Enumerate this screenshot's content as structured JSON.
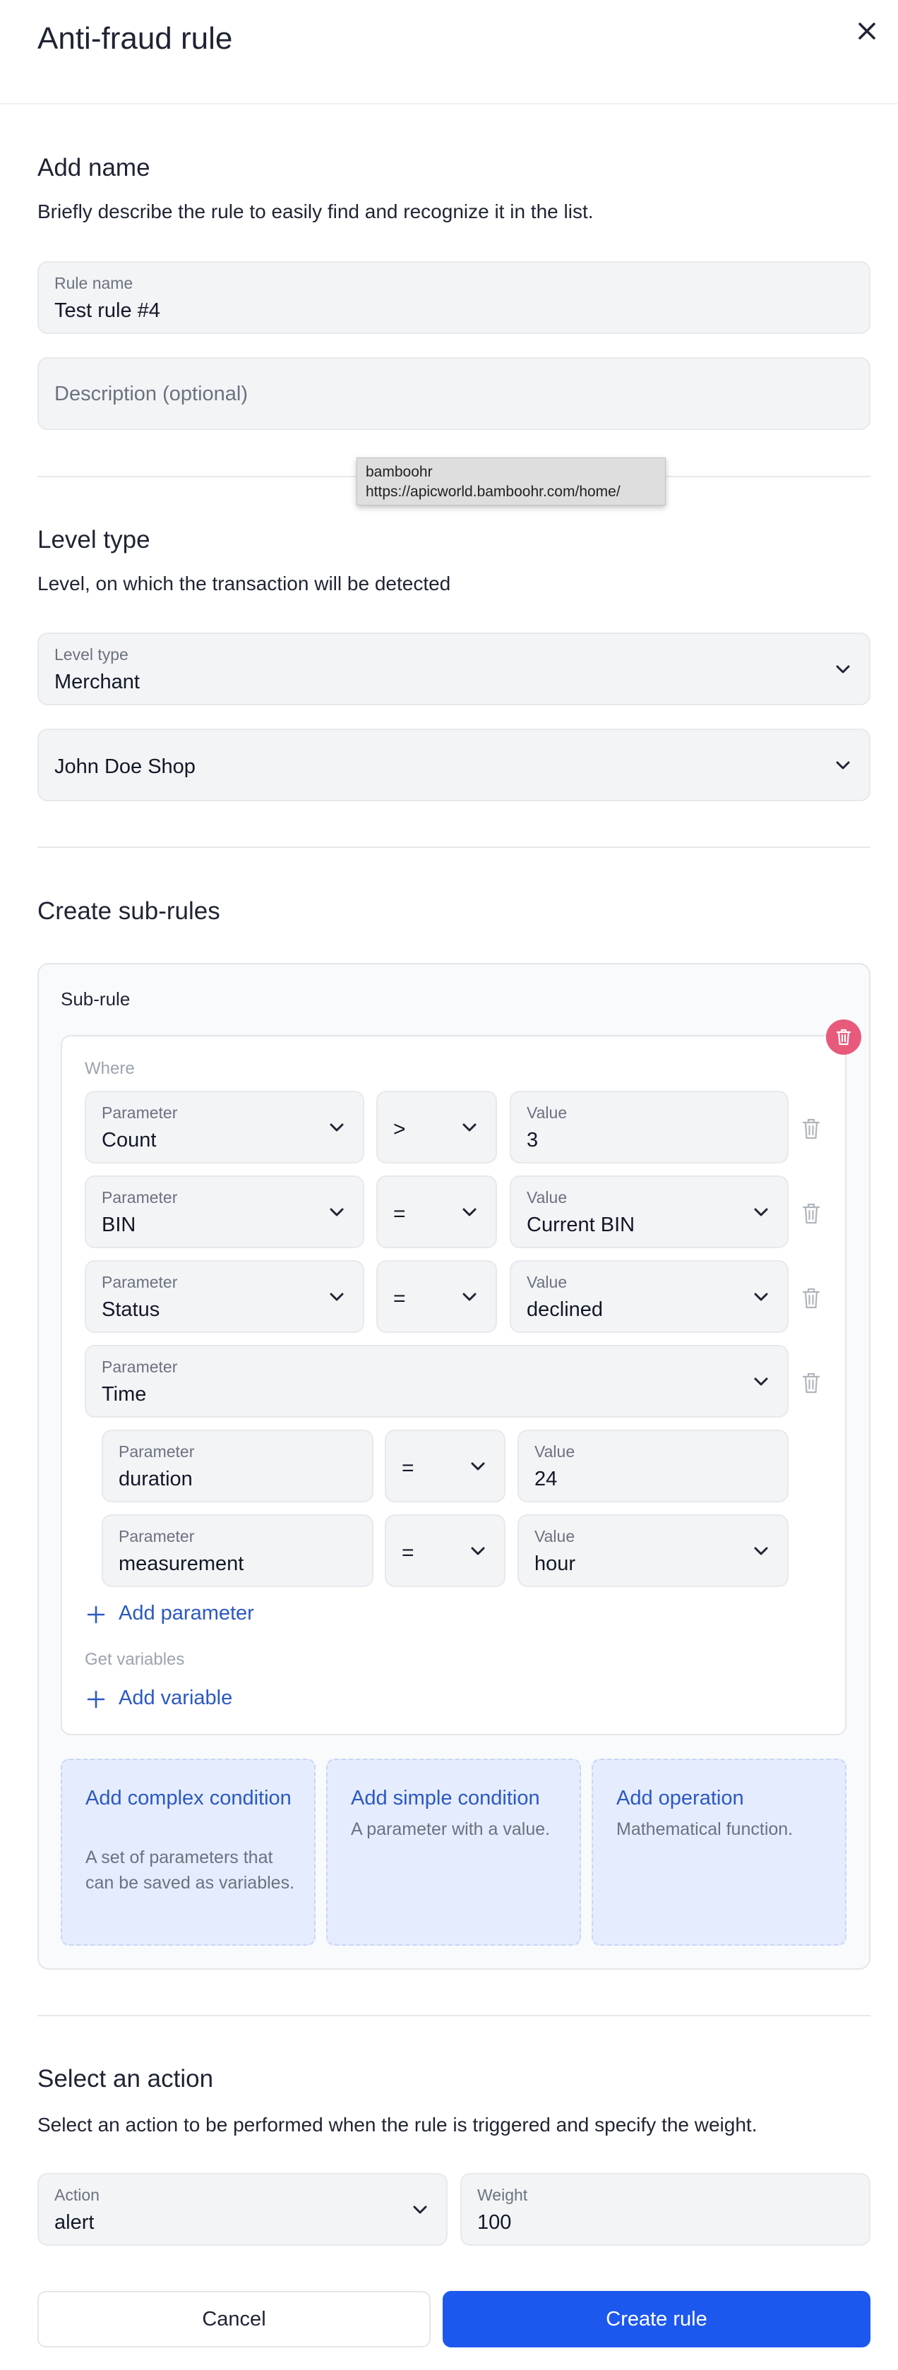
{
  "header": {
    "title": "Anti-fraud rule",
    "close_icon": "close-icon"
  },
  "name_section": {
    "heading": "Add name",
    "subtitle": "Briefly describe the rule to easily find and recognize it in the list.",
    "rule_name": {
      "label": "Rule name",
      "value": "Test rule #4"
    },
    "description": {
      "placeholder": "Description (optional)",
      "value": ""
    }
  },
  "tooltip": {
    "line1": "bamboohr",
    "line2": "https://apicworld.bamboohr.com/home/"
  },
  "level_section": {
    "heading": "Level type",
    "subtitle": "Level, on which the transaction will be detected",
    "level_type": {
      "label": "Level type",
      "value": "Merchant"
    },
    "merchant": {
      "value": "John Doe Shop"
    }
  },
  "subrules_section": {
    "heading": "Create sub-rules",
    "card_title": "Sub-rule",
    "where_label": "Where",
    "rows": [
      {
        "param_label": "Parameter",
        "param_value": "Count",
        "operator": ">",
        "value_label": "Value",
        "value": "3"
      },
      {
        "param_label": "Parameter",
        "param_value": "BIN",
        "operator": "=",
        "value_label": "Value",
        "value": "Current BIN"
      },
      {
        "param_label": "Parameter",
        "param_value": "Status",
        "operator": "=",
        "value_label": "Value",
        "value": "declined"
      },
      {
        "param_label": "Parameter",
        "param_value": "Time"
      }
    ],
    "nested_rows": [
      {
        "param_label": "Parameter",
        "param_value": "duration",
        "operator": "=",
        "value_label": "Value",
        "value": "24"
      },
      {
        "param_label": "Parameter",
        "param_value": "measurement",
        "operator": "=",
        "value_label": "Value",
        "value": "hour"
      }
    ],
    "add_parameter": "Add parameter",
    "get_variables_label": "Get variables",
    "add_variable": "Add variable",
    "cards": [
      {
        "title": "Add complex condition",
        "desc": "A set of parameters that can be saved as variables."
      },
      {
        "title": "Add simple condition",
        "desc": "A parameter with a value."
      },
      {
        "title": "Add operation",
        "desc": "Mathematical function."
      }
    ]
  },
  "action_section": {
    "heading": "Select an action",
    "subtitle": "Select an action to be performed when the rule is triggered and specify the weight.",
    "action": {
      "label": "Action",
      "value": "alert"
    },
    "weight": {
      "label": "Weight",
      "value": "100"
    }
  },
  "footer": {
    "cancel_label": "Cancel",
    "create_label": "Create rule"
  },
  "colors": {
    "primary": "#1d58ee",
    "link": "#2b59c3",
    "danger": "#e85a7b",
    "field_bg": "#f3f4f6",
    "card_bg": "#e5ecfd"
  }
}
